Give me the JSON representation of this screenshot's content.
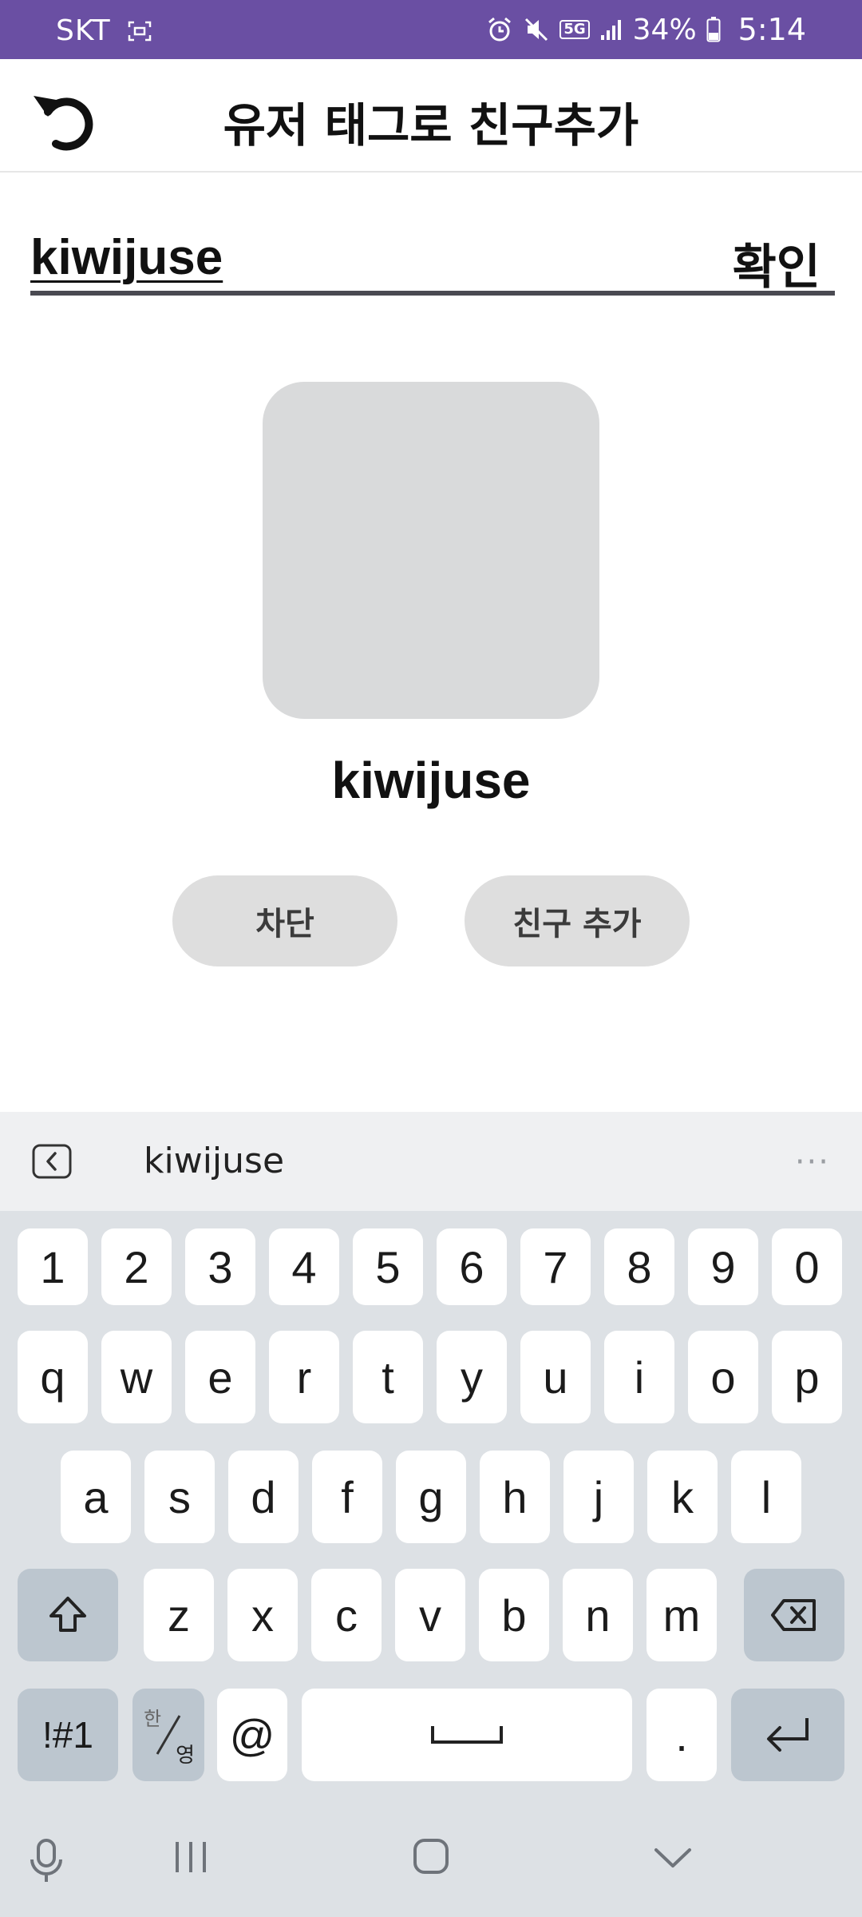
{
  "status_bar": {
    "carrier": "SKT",
    "network": "5G",
    "battery": "34%",
    "time": "5:14"
  },
  "header": {
    "title": "유저 태그로 친구추가"
  },
  "search": {
    "value": "kiwijuse",
    "confirm_label": "확인"
  },
  "profile": {
    "username": "kiwijuse"
  },
  "actions": {
    "block_label": "차단",
    "add_friend_label": "친구 추가"
  },
  "keyboard": {
    "suggestion": "kiwijuse",
    "more": "···",
    "number_row": [
      "1",
      "2",
      "3",
      "4",
      "5",
      "6",
      "7",
      "8",
      "9",
      "0"
    ],
    "row1": [
      "q",
      "w",
      "e",
      "r",
      "t",
      "y",
      "u",
      "i",
      "o",
      "p"
    ],
    "row2": [
      "a",
      "s",
      "d",
      "f",
      "g",
      "h",
      "j",
      "k",
      "l"
    ],
    "row3": [
      "z",
      "x",
      "c",
      "v",
      "b",
      "n",
      "m"
    ],
    "symbols_label": "!#1",
    "lang_top": "한",
    "lang_bottom": "영",
    "at_label": "@",
    "period_label": "."
  }
}
